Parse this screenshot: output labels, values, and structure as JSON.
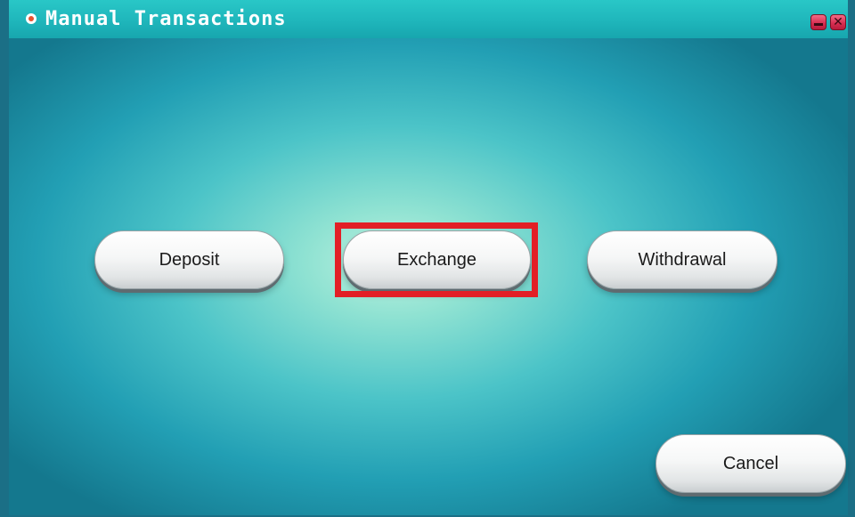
{
  "window": {
    "title": "Manual Transactions",
    "icons": {
      "app": "app-dot-icon",
      "minimize": "minimize-icon",
      "close": "close-icon"
    },
    "close_glyph": "✕"
  },
  "buttons": {
    "deposit": "Deposit",
    "exchange": "Exchange",
    "withdrawal": "Withdrawal",
    "cancel": "Cancel"
  },
  "highlight": {
    "target": "exchange-button",
    "color": "#e21f26"
  },
  "colors": {
    "titlebar": "#1fb6bb",
    "border": "#1b6f86",
    "background_center": "#bff2e0",
    "background_edge": "#14788e",
    "window_controls": "#d52c4f"
  }
}
